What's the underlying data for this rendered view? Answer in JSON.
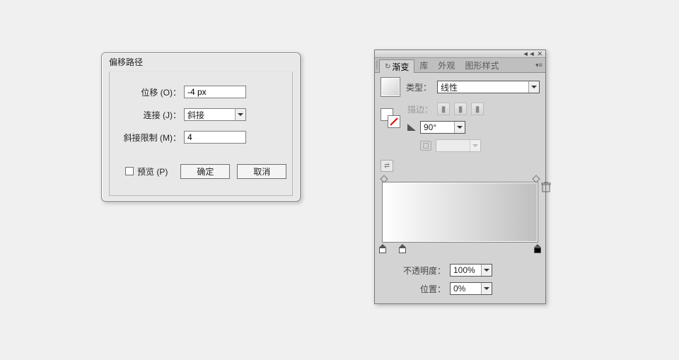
{
  "offset_dialog": {
    "title": "偏移路径",
    "offset_label": "位移 (O)：",
    "offset_value": "-4 px",
    "join_label": "连接 (J)：",
    "join_value": "斜接",
    "miter_label": "斜接限制 (M)：",
    "miter_value": "4",
    "preview_label": "预览 (P)",
    "ok_label": "确定",
    "cancel_label": "取消"
  },
  "gradient_panel": {
    "tabs": {
      "gradient": "渐变",
      "library": "库",
      "appearance": "外观",
      "graphic_styles": "图形样式"
    },
    "type_label": "类型：",
    "type_value": "线性",
    "stroke_label": "描边：",
    "angle_value": "90°",
    "opacity_label": "不透明度：",
    "opacity_value": "100%",
    "location_label": "位置：",
    "location_value": "0%"
  }
}
